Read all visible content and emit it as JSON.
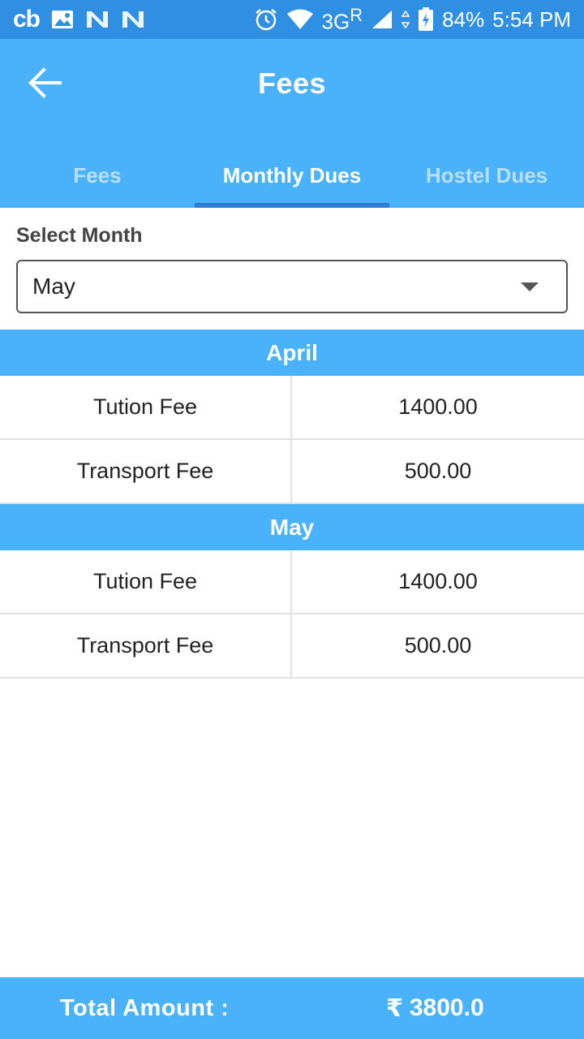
{
  "status_bar": {
    "left_icons": [
      "cb-app-icon",
      "image-icon",
      "n-app-icon",
      "n-app-icon"
    ],
    "carrier_label": "cb",
    "network": "3G",
    "roaming": "R",
    "battery": "84%",
    "time": "5:54 PM"
  },
  "app_bar": {
    "title": "Fees",
    "back_icon": "arrow-left-icon"
  },
  "tabs": [
    {
      "label": "Fees",
      "active": false
    },
    {
      "label": "Monthly Dues",
      "active": true
    },
    {
      "label": "Hostel Dues",
      "active": false
    }
  ],
  "month_select": {
    "label": "Select Month",
    "value": "May"
  },
  "sections": [
    {
      "month": "April",
      "rows": [
        {
          "name": "Tution Fee",
          "amount": "1400.00"
        },
        {
          "name": "Transport Fee",
          "amount": "500.00"
        }
      ]
    },
    {
      "month": "May",
      "rows": [
        {
          "name": "Tution Fee",
          "amount": "1400.00"
        },
        {
          "name": "Transport Fee",
          "amount": "500.00"
        }
      ]
    }
  ],
  "footer": {
    "total_label": "Total Amount :",
    "currency_symbol": "₹",
    "total_value": "3800.0"
  },
  "colors": {
    "status_bar": "#2f8fe3",
    "primary": "#4ab2fb",
    "tab_indicator": "#2f7fd6"
  }
}
